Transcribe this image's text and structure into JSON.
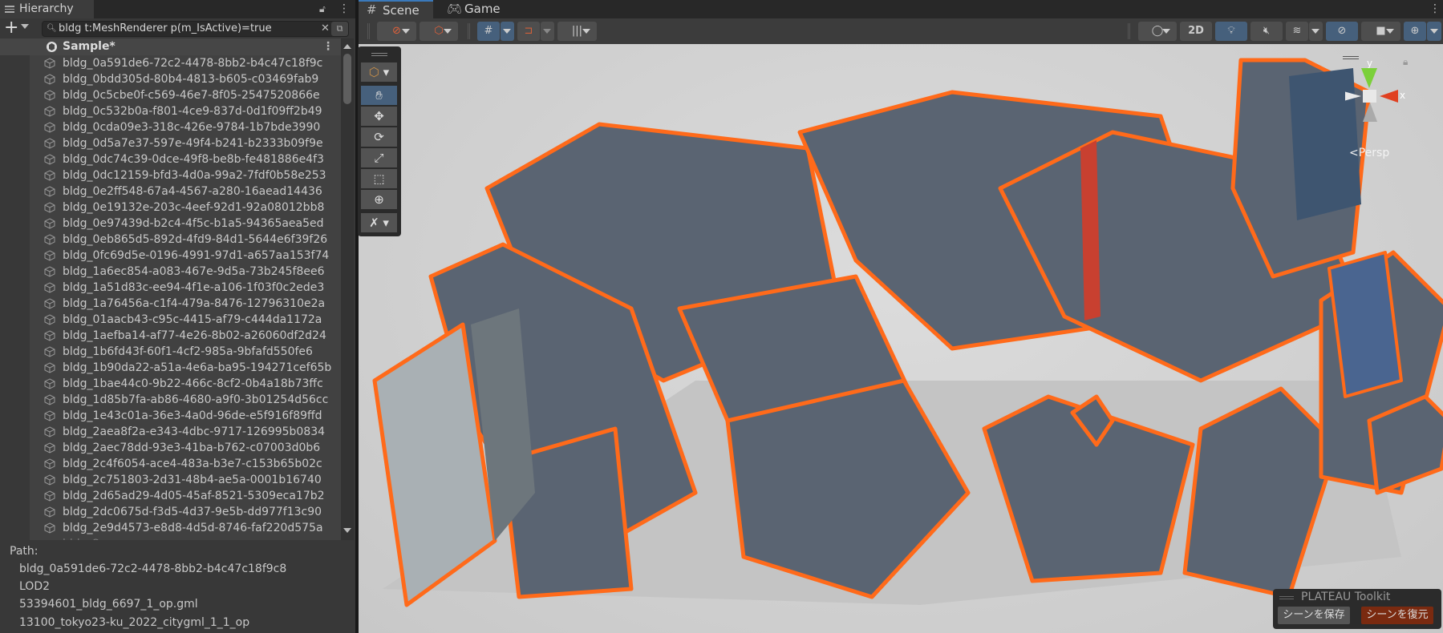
{
  "hierarchy": {
    "tab_label": "Hierarchy",
    "search_value": "bldg t:MeshRenderer p(m_IsActive)=true",
    "scene_name": "Sample*",
    "items": [
      "bldg_0a591de6-72c2-4478-8bb2-b4c47c18f9c",
      "bldg_0bdd305d-80b4-4813-b605-c03469fab9",
      "bldg_0c5cbe0f-c569-46e7-8f05-2547520866e",
      "bldg_0c532b0a-f801-4ce9-837d-0d1f09ff2b49",
      "bldg_0cda09e3-318c-426e-9784-1b7bde3990",
      "bldg_0d5a7e37-597e-49f4-b241-b2333b09f9e",
      "bldg_0dc74c39-0dce-49f8-be8b-fe481886e4f3",
      "bldg_0dc12159-bfd3-4d0a-99a2-7fdf0b58e253",
      "bldg_0e2ff548-67a4-4567-a280-16aead14436",
      "bldg_0e19132e-203c-4eef-92d1-92a08012bb8",
      "bldg_0e97439d-b2c4-4f5c-b1a5-94365aea5ed",
      "bldg_0eb865d5-892d-4fd9-84d1-5644e6f39f26",
      "bldg_0fc69d5e-0196-4991-97d1-a657aa153f74",
      "bldg_1a6ec854-a083-467e-9d5a-73b245f8ee6",
      "bldg_1a51d83c-ee94-4f1e-a106-1f03f0c2ede3",
      "bldg_1a76456a-c1f4-479a-8476-12796310e2a",
      "bldg_01aacb43-c95c-4415-af79-c444da1172a",
      "bldg_1aefba14-af77-4e26-8b02-a26060df2d24",
      "bldg_1b6fd43f-60f1-4cf2-985a-9bfafd550fe6",
      "bldg_1b90da22-a51a-4e6a-ba95-194271cef65b",
      "bldg_1bae44c0-9b22-466c-8cf2-0b4a18b73ffc",
      "bldg_1d85b7fa-ab86-4680-a9f0-3b01254d56cc",
      "bldg_1e43c01a-36e3-4a0d-96de-e5f916f89ffd",
      "bldg_2aea8f2a-e343-4dbc-9717-126995b0834",
      "bldg_2aec78dd-93e3-41ba-b762-c07003d0b6",
      "bldg_2c4f6054-ace4-483a-b3e7-c153b65b02c",
      "bldg_2c751803-2d31-48b4-ae5a-0001b16740",
      "bldg_2d65ad29-4d05-45af-8521-5309eca17b2",
      "bldg_2dc0675d-f3d5-4d37-9e5b-dd977f13c90",
      "bldg_2e9d4573-e8d8-4d5d-8746-faf220d575a"
    ],
    "path_label": "Path:",
    "path": [
      "bldg_0a591de6-72c2-4478-8bb2-b4c47c18f9c8",
      "LOD2",
      "53394601_bldg_6697_1_op.gml",
      "13100_tokyo23-ku_2022_citygml_1_1_op"
    ]
  },
  "scene": {
    "tabs": [
      {
        "label": "Scene",
        "icon": "grid-icon",
        "active": true
      },
      {
        "label": "Game",
        "icon": "gamepad-icon",
        "active": false
      }
    ],
    "toolbar": {
      "mode_2d": "2D"
    },
    "tools": [
      "view-tool",
      "move-tool",
      "rotate-tool",
      "scale-tool",
      "rect-tool",
      "transform-tool",
      "custom-tool"
    ],
    "gizmo": {
      "y_label": "y",
      "x_label": "x",
      "projection": "Persp"
    },
    "selection_outline_color": "#ff6a1a"
  },
  "plateau_toolkit": {
    "title": "PLATEAU Toolkit",
    "save_label": "シーンを保存",
    "restore_label": "シーンを復元",
    "restore_color": "#7a2a10"
  }
}
